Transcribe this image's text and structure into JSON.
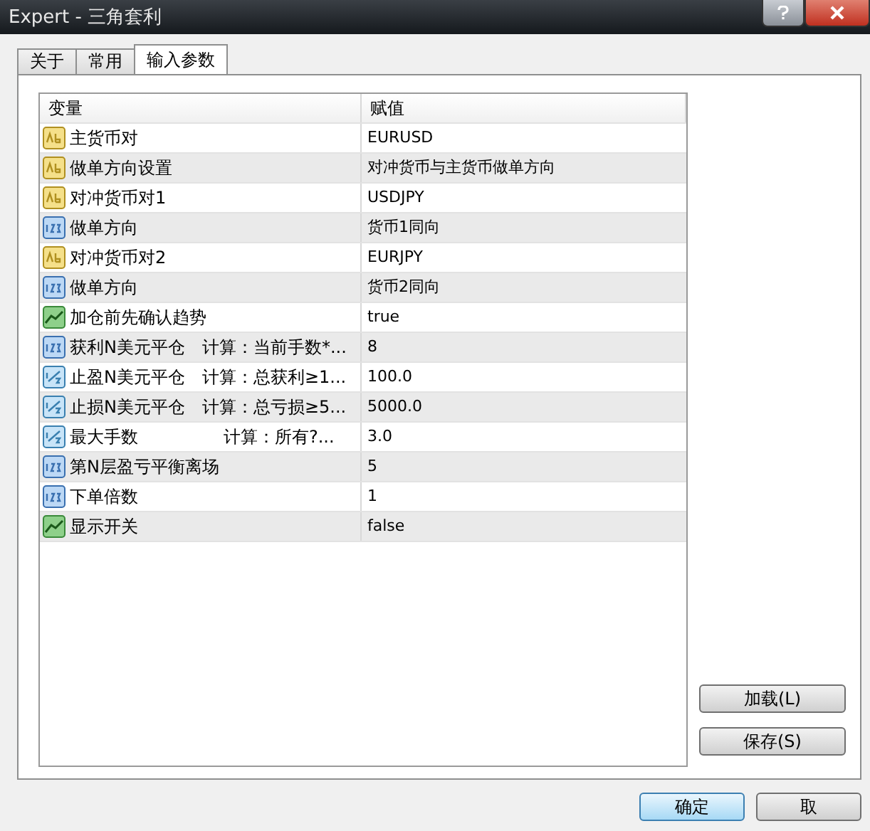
{
  "window": {
    "title": "Expert - 三角套利"
  },
  "tabs": [
    {
      "label": "关于",
      "selected": false
    },
    {
      "label": "常用",
      "selected": false
    },
    {
      "label": "输入参数",
      "selected": true
    }
  ],
  "table": {
    "columns": [
      "变量",
      "赋值"
    ],
    "rows": [
      {
        "kind": "string",
        "name": "主货币对",
        "value": "EURUSD"
      },
      {
        "kind": "string",
        "name": "做单方向设置",
        "value": "对冲货币与主货币做单方向"
      },
      {
        "kind": "string",
        "name": "对冲货币对1",
        "value": "USDJPY"
      },
      {
        "kind": "integer",
        "name": "做单方向",
        "value": "货币1同向"
      },
      {
        "kind": "string",
        "name": "对冲货币对2",
        "value": "EURJPY"
      },
      {
        "kind": "integer",
        "name": "做单方向",
        "value": "货币2同向"
      },
      {
        "kind": "bool",
        "name": "加仓前先确认趋势",
        "value": "true"
      },
      {
        "kind": "integer",
        "name": "获利N美元平仓　计算：当前手数*...",
        "value": "8"
      },
      {
        "kind": "double",
        "name": "止盈N美元平仓　计算：总获利≥1...",
        "value": "100.0"
      },
      {
        "kind": "double",
        "name": "止损N美元平仓　计算：总亏损≥5...",
        "value": "5000.0"
      },
      {
        "kind": "double",
        "name": "最大手数　　　　　计算：所有?...",
        "value": "3.0"
      },
      {
        "kind": "integer",
        "name": "第N层盈亏平衡离场",
        "value": "5"
      },
      {
        "kind": "integer",
        "name": "下单倍数",
        "value": "1"
      },
      {
        "kind": "bool",
        "name": "显示开关",
        "value": "false"
      }
    ]
  },
  "side_buttons": [
    "加载(L)",
    "保存(S)"
  ],
  "footer_buttons": [
    {
      "label": "确定",
      "selected": true
    },
    {
      "label": "取",
      "selected": false
    }
  ]
}
